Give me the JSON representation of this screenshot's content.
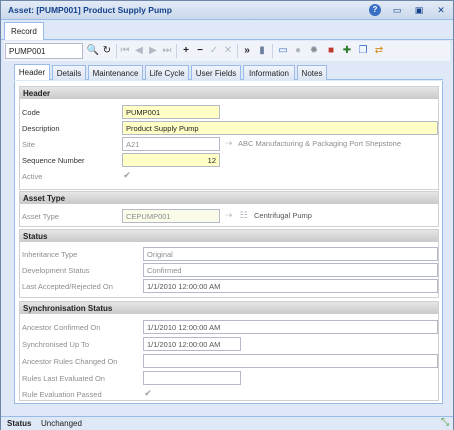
{
  "window": {
    "title": "Asset: [PUMP001] Product Supply Pump",
    "controls": [
      "help-icon",
      "minimize-icon",
      "maximize-icon",
      "close-icon"
    ]
  },
  "outer_tab": "Record",
  "toolbar": {
    "record_code": "PUMP001",
    "icons": [
      "search-icon",
      "refresh-icon",
      "first-icon",
      "previous-icon",
      "next-icon",
      "last-icon",
      "add-icon",
      "delete-icon",
      "save-icon",
      "cancel-icon",
      "more-icon",
      "document-icon",
      "window-icon",
      "globe-icon",
      "settings-icon",
      "book-icon",
      "tools-icon",
      "copy-icon",
      "sync-icon"
    ]
  },
  "tabs": [
    "Header",
    "Details",
    "Maintenance",
    "Life Cycle",
    "User Fields",
    "Information",
    "Notes"
  ],
  "active_tab": "Header",
  "header_section": {
    "title": "Header",
    "code_label": "Code",
    "code_value": "PUMP001",
    "description_label": "Description",
    "description_value": "Product Supply Pump",
    "site_label": "Site",
    "site_value": "A21",
    "site_name": "ABC Manufacturing & Packaging Port Shepstone",
    "sequence_label": "Sequence Number",
    "sequence_value": "12",
    "active_label": "Active",
    "active_checked": true
  },
  "asset_type_section": {
    "title": "Asset Type",
    "type_label": "Asset Type",
    "type_value": "CEPUMP001",
    "type_name": "Centrifugal Pump"
  },
  "status_section": {
    "title": "Status",
    "inheritance_label": "Inheritance Type",
    "inheritance_value": "Original",
    "development_label": "Development Status",
    "development_value": "Confirmed",
    "accepted_label": "Last Accepted/Rejected On",
    "accepted_value": "1/1/2010 12:00:00 AM"
  },
  "sync_section": {
    "title": "Synchronisation Status",
    "ancestor_confirmed_label": "Ancestor Confirmed On",
    "ancestor_confirmed_value": "1/1/2010 12:00:00 AM",
    "synchronised_label": "Synchronised Up To",
    "synchronised_value": "1/1/2010 12:00:00 AM",
    "rules_changed_label": "Ancestor Rules Changed On",
    "rules_changed_value": "",
    "rules_evaluated_label": "Rules Last Evaluated On",
    "rules_evaluated_value": "",
    "rule_passed_label": "Rule Evaluation Passed",
    "rule_passed_checked": true
  },
  "status_bar": {
    "label": "Status",
    "value": "Unchanged"
  }
}
